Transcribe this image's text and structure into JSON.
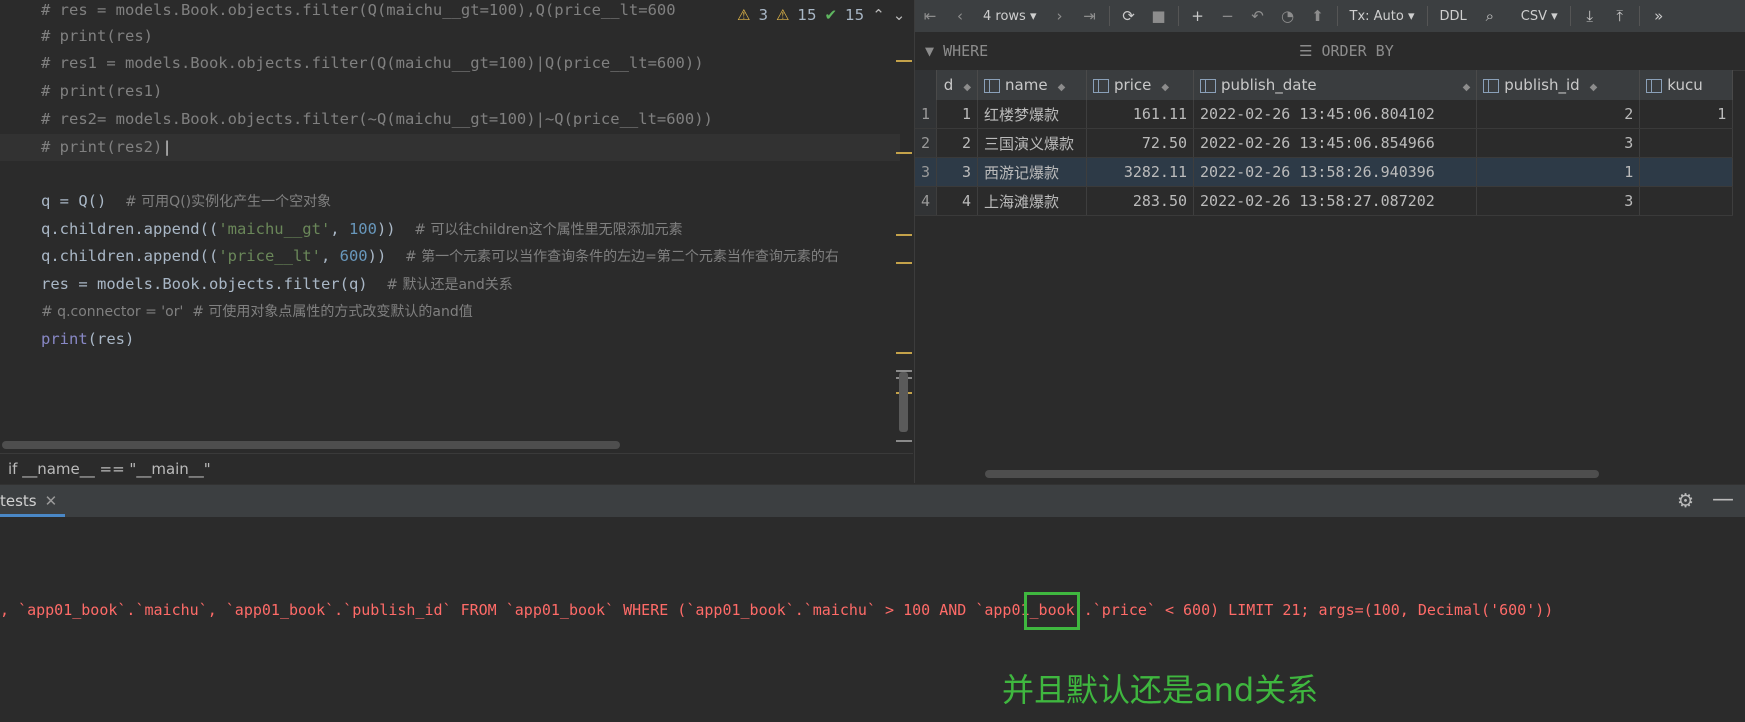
{
  "editor": {
    "badges": {
      "warnings": "3",
      "weak_warnings": "15",
      "typos": "15"
    },
    "lines": [
      {
        "text": "# res = models.Book.objects.filter(Q(maichu__gt=100),Q(price__lt=600"
      },
      {
        "text": "# print(res)"
      },
      {
        "text": "# res1 = models.Book.objects.filter(Q(maichu__gt=100)|Q(price__lt=600))"
      },
      {
        "text": "# print(res1)"
      },
      {
        "text": "# res2= models.Book.objects.filter(~Q(maichu__gt=100)|~Q(price__lt=600))"
      },
      {
        "text": "# print(res2)"
      }
    ],
    "code": {
      "l7_a": "q = Q()  ",
      "l7_c": "# 可用Q()实例化产生一个空对象",
      "l8_a": "q.children.append((",
      "l8_s": "'maichu__gt'",
      "l8_b": ", ",
      "l8_n": "100",
      "l8_e": "))  ",
      "l8_c": "# 可以往children这个属性里无限添加元素",
      "l9_a": "q.children.append((",
      "l9_s": "'price__lt'",
      "l9_b": ", ",
      "l9_n": "600",
      "l9_e": "))  ",
      "l9_c": "# 第一个元素可以当作查询条件的左边=第二个元素当作查询元素的右",
      "l10_a": "res = models.Book.objects.filter(q)  ",
      "l10_c": "# 默认还是and关系",
      "l11_c": "# q.connector = 'or'  # 可使用对象点属性的方式改变默认的and值",
      "l12_f": "print",
      "l12_e": "(res)"
    },
    "breadcrumb": "if __name__ == \"__main__\""
  },
  "db_panel": {
    "toolbar": {
      "rows": "4 rows",
      "tx": "Tx: Auto",
      "ddl": "DDL",
      "export": "CSV"
    },
    "filter": {
      "where": "WHERE",
      "order_by": "ORDER BY"
    },
    "columns": [
      "d",
      "name",
      "price",
      "publish_date",
      "publish_id",
      "kucu"
    ],
    "rows": [
      {
        "rn": "1",
        "id": "1",
        "name": "红楼梦爆款",
        "price": "161.11",
        "publish_date": "2022-02-26 13:45:06.804102",
        "publish_id": "2",
        "kucun": "1"
      },
      {
        "rn": "2",
        "id": "2",
        "name": "三国演义爆款",
        "price": "72.50",
        "publish_date": "2022-02-26 13:45:06.854966",
        "publish_id": "3",
        "kucun": ""
      },
      {
        "rn": "3",
        "id": "3",
        "name": "西游记爆款",
        "price": "3282.11",
        "publish_date": "2022-02-26 13:58:26.940396",
        "publish_id": "1",
        "kucun": ""
      },
      {
        "rn": "4",
        "id": "4",
        "name": "上海滩爆款",
        "price": "283.50",
        "publish_date": "2022-02-26 13:58:27.087202",
        "publish_id": "3",
        "kucun": ""
      }
    ]
  },
  "run_panel": {
    "tab": "tests",
    "sql_output": ", `app01_book`.`maichu`, `app01_book`.`publish_id` FROM `app01_book` WHERE (`app01_book`.`maichu` > 100 AND `app01_book`.`price` < 600) LIMIT 21; args=(100, Decimal('600'))",
    "caption": "并且默认还是and关系"
  },
  "colors": {
    "accent_green": "#3fb73f",
    "sql_red": "#ff6b68",
    "comment_gray": "#808080",
    "string_green": "#6a8759",
    "number_blue": "#6897bb"
  }
}
